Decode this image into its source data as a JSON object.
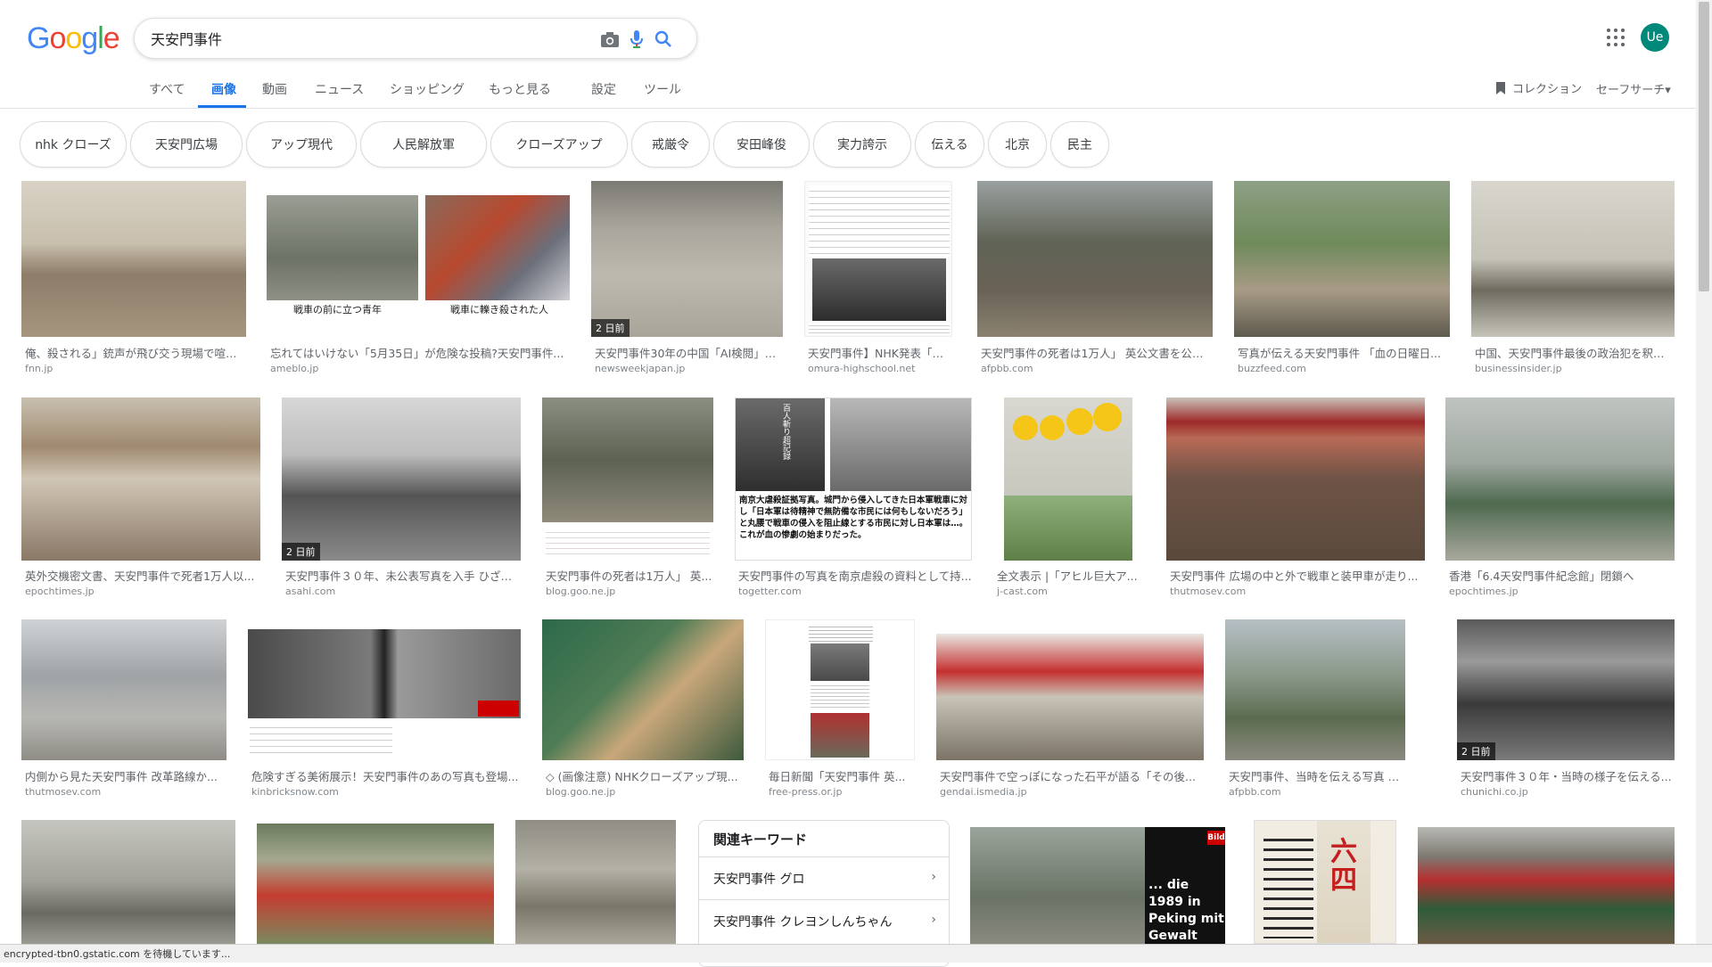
{
  "logo": [
    "G",
    "o",
    "o",
    "g",
    "l",
    "e"
  ],
  "search": {
    "value": "天安門事件"
  },
  "tabs": [
    "すべて",
    "画像",
    "動画",
    "ニュース",
    "ショッピング",
    "もっと見る",
    "設定",
    "ツール"
  ],
  "header_right": {
    "collections": "コレクション",
    "safesearch": "セーフサーチ▾",
    "avatar": "Ue"
  },
  "chips": [
    "nhk クローズ",
    "天安門広場",
    "アップ現代",
    "人民解放軍",
    "クローズアップ",
    "戒厳令",
    "安田峰俊",
    "実力誇示",
    "伝える",
    "北京",
    "民主"
  ],
  "results": [
    {
      "caption": "俺、殺される」銃声が飛び交う現場で喧吐...",
      "source": "fnn.jp",
      "badge": ""
    },
    {
      "caption": "忘れてはいけない「5月35日」が危険な投稿?天安門事件...",
      "source": "ameblo.jp",
      "badge": ""
    },
    {
      "caption": "天安門事件30年の中国「AI検閲」フ...",
      "source": "newsweekjapan.jp",
      "badge": "2 日前"
    },
    {
      "caption": "天安門事件】NHK発表「犠...",
      "source": "omura-highschool.net",
      "badge": ""
    },
    {
      "caption": "天安門事件の死者は1万人」 英公文書を公開...",
      "source": "afpbb.com",
      "badge": ""
    },
    {
      "caption": "写真が伝える天安門事件 「血の日曜日...",
      "source": "buzzfeed.com",
      "badge": ""
    },
    {
      "caption": "中国、天安門事件最後の政治犯を釈放...",
      "source": "businessinsider.jp",
      "badge": ""
    },
    {
      "caption": "英外交機密文書、天安門事件で死者1万人以...",
      "source": "epochtimes.jp",
      "badge": ""
    },
    {
      "caption": "天安門事件３０年、未公表写真を入手 ひざま...",
      "source": "asahi.com",
      "badge": "2 日前"
    },
    {
      "caption": "天安門事件の死者は1万人」 英...",
      "source": "blog.goo.ne.jp",
      "badge": ""
    },
    {
      "caption": "天安門事件の写真を南京虐殺の資料として持...",
      "source": "togetter.com",
      "badge": ""
    },
    {
      "caption": "全文表示 |「アヒル巨大ア...",
      "source": "j-cast.com",
      "badge": ""
    },
    {
      "caption": "天安門事件 広場の中と外で戦車と装甲車が走り...",
      "source": "thutmosev.com",
      "badge": ""
    },
    {
      "caption": "香港「6.4天安門事件紀念館」閉鎖へ",
      "source": "epochtimes.jp",
      "badge": ""
    },
    {
      "caption": "内側から見た天安門事件 改革路線か...",
      "source": "thutmosev.com",
      "badge": ""
    },
    {
      "caption": "危険すぎる美術展示！天安門事件のあの写真も登場...",
      "source": "kinbricksnow.com",
      "badge": ""
    },
    {
      "caption": "◇ (画像注意) NHKクローズアップ現...",
      "source": "blog.goo.ne.jp",
      "badge": ""
    },
    {
      "caption": "毎日新聞「天安門事件 英...",
      "source": "free-press.or.jp",
      "badge": ""
    },
    {
      "caption": "天安門事件で空っぽになった石平が語る「その後...",
      "source": "gendai.ismedia.jp",
      "badge": ""
    },
    {
      "caption": "天安門事件、当時を伝える写真 写真41...",
      "source": "afpbb.com",
      "badge": ""
    },
    {
      "caption": "天安門事件３０年・当時の様子を伝える...",
      "source": "chunichi.co.jp",
      "badge": "2 日前"
    }
  ],
  "image_texts": {
    "img1_left": "戦車の前に立つ青年",
    "img1_right": "戦車に轢き殺された人",
    "img10_text": "南京大虐殺証拠写真。城門から侵入してきた日本軍戦車に対し「日本軍は待精神で無防備な市民には何もしないだろう」と丸腰で戦車の侵入を阻止線とする市民に対し日本軍は…。これが血の惨劇の始まりだった。",
    "img10_headline": "百人斬り超記録",
    "img22_text": "... die 1989 in Peking mit Gewalt niedergeschlagen",
    "img22_brand": "Bild",
    "img24_text": "六四"
  },
  "related": {
    "title": "関連キーワード",
    "items": [
      "天安門事件 グロ",
      "天安門事件 クレヨンしんちゃん"
    ]
  },
  "statusbar": "encrypted-tbn0.gstatic.com を待機しています..."
}
